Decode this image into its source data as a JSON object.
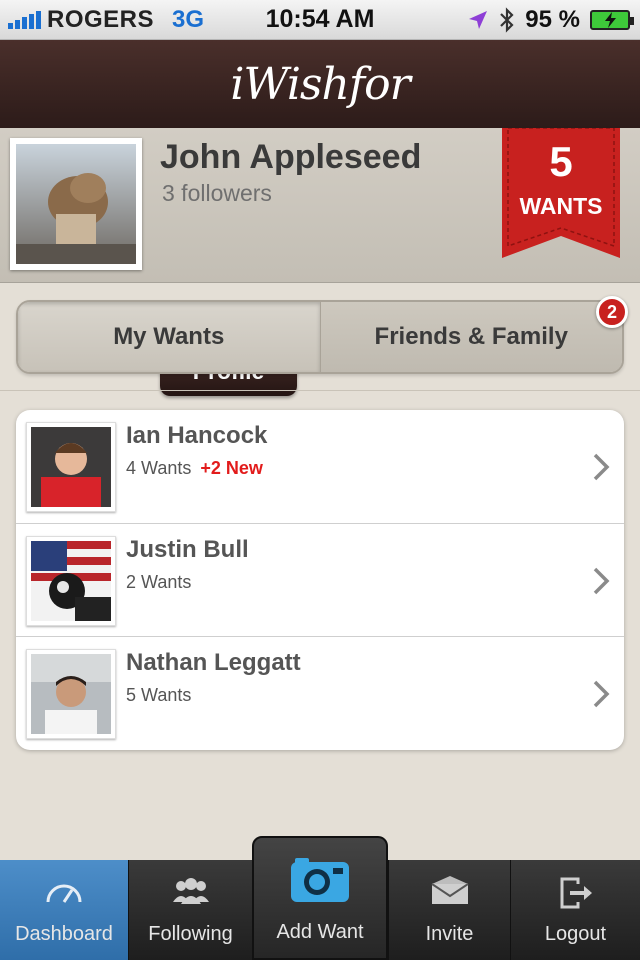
{
  "status_bar": {
    "carrier": "ROGERS",
    "network": "3G",
    "time": "10:54 AM",
    "battery": "95 %"
  },
  "nav": {
    "logo": "iWishfor"
  },
  "profile": {
    "name": "John Appleseed",
    "followers": "3 followers",
    "button_label": "Profile",
    "wants_count": "5",
    "wants_label": "WANTS"
  },
  "segments": {
    "my_wants": "My Wants",
    "friends_family": "Friends & Family",
    "badge": "2"
  },
  "friends": [
    {
      "name": "Ian Hancock",
      "wants": "4 Wants",
      "new": "+2 New"
    },
    {
      "name": "Justin Bull",
      "wants": "2 Wants",
      "new": ""
    },
    {
      "name": "Nathan Leggatt",
      "wants": "5 Wants",
      "new": ""
    }
  ],
  "tabbar": {
    "dashboard": "Dashboard",
    "following": "Following",
    "add_want": "Add Want",
    "invite": "Invite",
    "logout": "Logout"
  },
  "colors": {
    "nav_brown": "#3a2422",
    "ribbon_red": "#c8211f",
    "active_tab_blue": "#3a7dba",
    "new_red": "#e21b1b"
  }
}
